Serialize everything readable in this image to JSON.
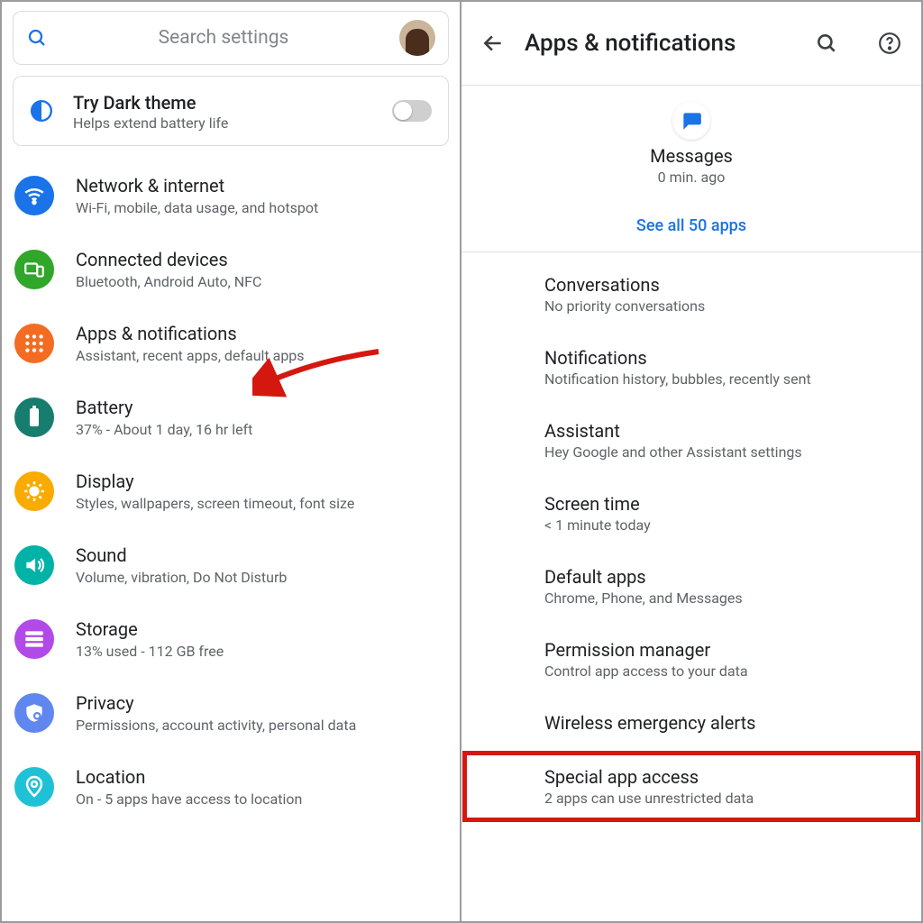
{
  "left": {
    "search_placeholder": "Search settings",
    "dark_theme": {
      "title": "Try Dark theme",
      "sub": "Helps extend battery life"
    },
    "items": [
      {
        "title": "Network & internet",
        "sub": "Wi-Fi, mobile, data usage, and hotspot",
        "icon": "wifi",
        "color": "#1a73e8"
      },
      {
        "title": "Connected devices",
        "sub": "Bluetooth, Android Auto, NFC",
        "icon": "devices",
        "color": "#30a62a"
      },
      {
        "title": "Apps & notifications",
        "sub": "Assistant, recent apps, default apps",
        "icon": "apps",
        "color": "#f36c21"
      },
      {
        "title": "Battery",
        "sub": "37% - About 1 day, 16 hr left",
        "icon": "battery",
        "color": "#177e6f"
      },
      {
        "title": "Display",
        "sub": "Styles, wallpapers, screen timeout, font size",
        "icon": "brightness",
        "color": "#f9ab00"
      },
      {
        "title": "Sound",
        "sub": "Volume, vibration, Do Not Disturb",
        "icon": "volume",
        "color": "#00b3a6"
      },
      {
        "title": "Storage",
        "sub": "13% used - 112 GB free",
        "icon": "storage",
        "color": "#b14ae8"
      },
      {
        "title": "Privacy",
        "sub": "Permissions, account activity, personal data",
        "icon": "privacy",
        "color": "#5f87ef"
      },
      {
        "title": "Location",
        "sub": "On - 5 apps have access to location",
        "icon": "location",
        "color": "#1fc1d6"
      }
    ]
  },
  "right": {
    "title": "Apps & notifications",
    "recent": {
      "name": "Messages",
      "time": "0 min. ago",
      "see_all": "See all 50 apps"
    },
    "items": [
      {
        "title": "Conversations",
        "sub": "No priority conversations"
      },
      {
        "title": "Notifications",
        "sub": "Notification history, bubbles, recently sent"
      },
      {
        "title": "Assistant",
        "sub": "Hey Google and other Assistant settings"
      },
      {
        "title": "Screen time",
        "sub": "< 1 minute today"
      },
      {
        "title": "Default apps",
        "sub": "Chrome, Phone, and Messages"
      },
      {
        "title": "Permission manager",
        "sub": "Control app access to your data"
      },
      {
        "title": "Wireless emergency alerts",
        "sub": ""
      },
      {
        "title": "Special app access",
        "sub": "2 apps can use unrestricted data"
      }
    ],
    "highlight_index": 7
  }
}
